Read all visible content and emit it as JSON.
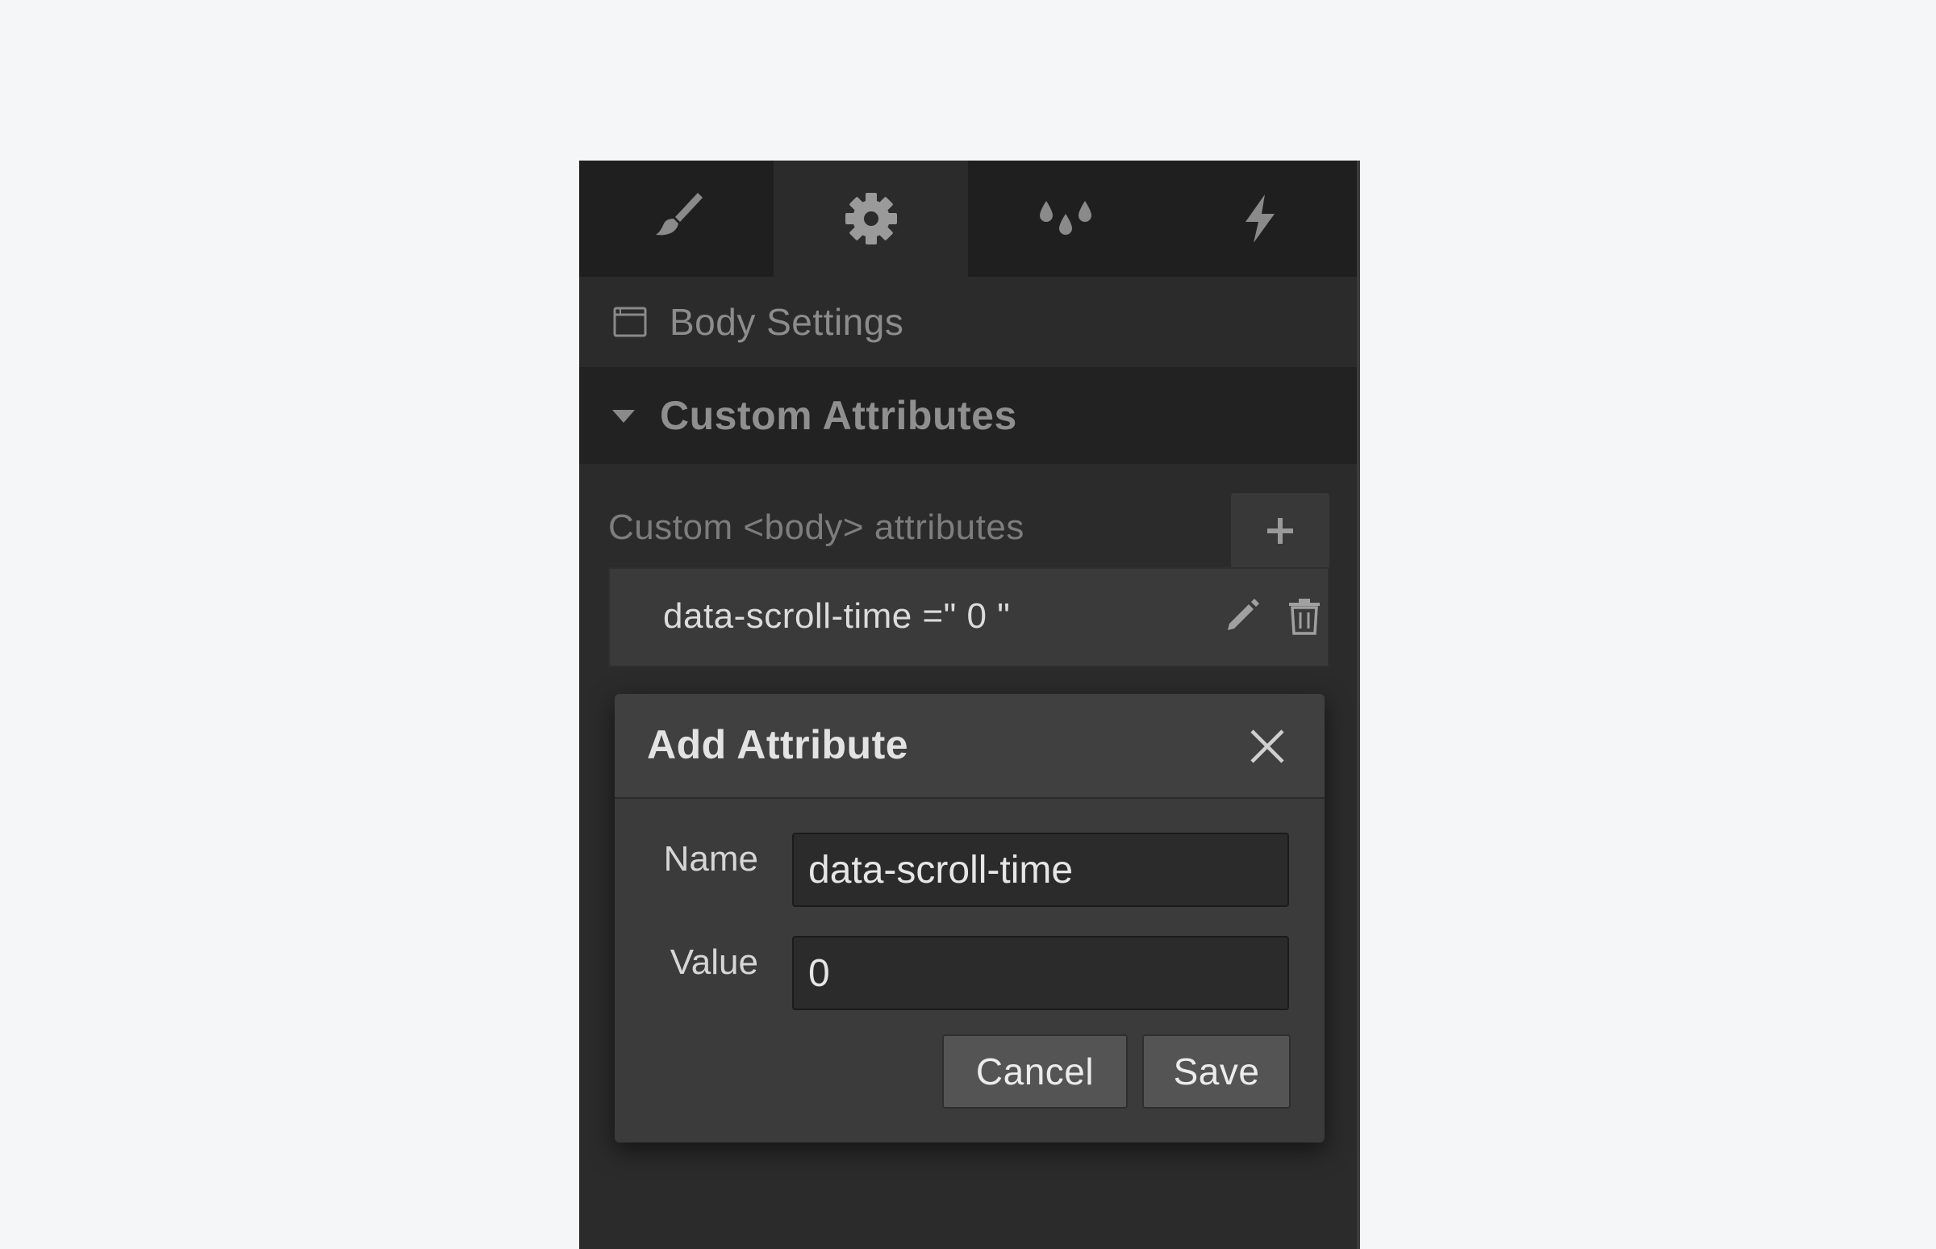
{
  "tabs": [
    {
      "icon": "brush-icon",
      "active": false
    },
    {
      "icon": "gear-icon",
      "active": true
    },
    {
      "icon": "drops-icon",
      "active": false
    },
    {
      "icon": "lightning-icon",
      "active": false
    }
  ],
  "settings": {
    "title": "Body Settings",
    "icon": "window-icon"
  },
  "section": {
    "title": "Custom Attributes",
    "expanded": true
  },
  "attributes": {
    "label": "Custom <body> attributes",
    "add_icon": "plus-icon",
    "items": [
      {
        "text": "data-scroll-time =\" 0 \"",
        "edit_icon": "pencil-icon",
        "delete_icon": "trash-icon"
      }
    ]
  },
  "dialog": {
    "title": "Add Attribute",
    "close_icon": "close-icon",
    "name_label": "Name",
    "name_value": "data-scroll-time",
    "value_label": "Value",
    "value_value": "0",
    "cancel_label": "Cancel",
    "save_label": "Save"
  },
  "colors": {
    "page_bg": "#f5f6f8",
    "panel_bg": "#2b2b2b",
    "tabbar_bg": "#1f1f1f",
    "icon_gray": "#8a8a8a"
  }
}
